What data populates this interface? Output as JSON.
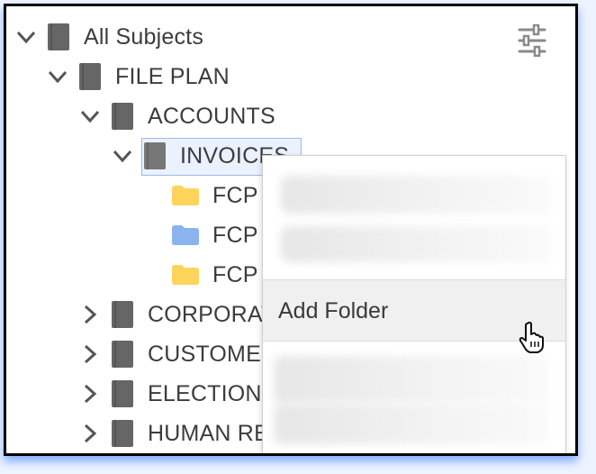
{
  "filter_icon": "filter-sliders-icon",
  "tree": {
    "root": {
      "label": "All Subjects",
      "icon": "book-icon",
      "expanded": true
    },
    "file_plan": {
      "label": "FILE PLAN",
      "icon": "book-icon",
      "expanded": true
    },
    "accounts": {
      "label": "ACCOUNTS",
      "icon": "book-icon",
      "expanded": true
    },
    "invoices": {
      "label": "INVOICES",
      "icon": "book-icon",
      "expanded": true,
      "selected": true
    },
    "children": [
      {
        "label": "FCP",
        "icon": "folder-icon",
        "color": "#ffd45c"
      },
      {
        "label": "FCP",
        "icon": "folder-icon",
        "color": "#8ab4f0"
      },
      {
        "label": "FCP",
        "icon": "folder-icon",
        "color": "#ffd45c"
      }
    ],
    "siblings": [
      {
        "label": "CORPORATE",
        "icon": "book-icon"
      },
      {
        "label": "CUSTOMER",
        "icon": "book-icon"
      },
      {
        "label": "ELECTIONS",
        "icon": "book-icon"
      },
      {
        "label": "HUMAN RESOURCES",
        "icon": "book-icon"
      }
    ]
  },
  "context_menu": {
    "items": [
      {
        "label": "",
        "blurred": true
      },
      {
        "label": "Add Folder",
        "hovered": true
      },
      {
        "label": "",
        "blurred": true
      }
    ]
  },
  "cursor": "hand-pointer-icon",
  "colors": {
    "folder_yellow": "#ffd45c",
    "folder_blue": "#8ab4f0",
    "book": "#666666",
    "selection_border": "#9eb8e8",
    "frame_shadow": "#286eff"
  }
}
